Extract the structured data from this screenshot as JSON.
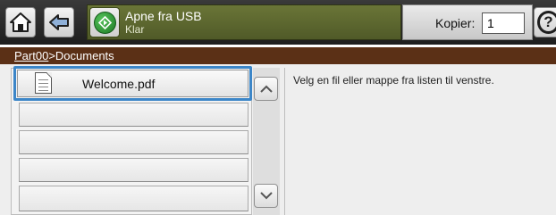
{
  "toolbar": {
    "home_icon": "home-icon",
    "back_icon": "back-arrow-icon",
    "start_icon": "start-diamond-icon",
    "help_icon": "help-icon",
    "help_glyph": "?",
    "title": "Apne fra USB",
    "status": "Klar",
    "copies_label": "Kopier:",
    "copies_value": "1"
  },
  "breadcrumb": {
    "parent": "Part00",
    "separator": ">",
    "current": "Documents"
  },
  "file_list": {
    "items": [
      {
        "name": "Welcome.pdf",
        "selected": true
      },
      {
        "name": "",
        "selected": false
      },
      {
        "name": "",
        "selected": false
      },
      {
        "name": "",
        "selected": false
      },
      {
        "name": "",
        "selected": false
      }
    ]
  },
  "info": {
    "message": "Velg en fil eller mappe fra listen til venstre."
  },
  "colors": {
    "status_panel": "#5e6a2f",
    "breadcrumb_bar": "#5b3016",
    "selection": "#3c86c8",
    "start_button": "#2e9a35"
  }
}
